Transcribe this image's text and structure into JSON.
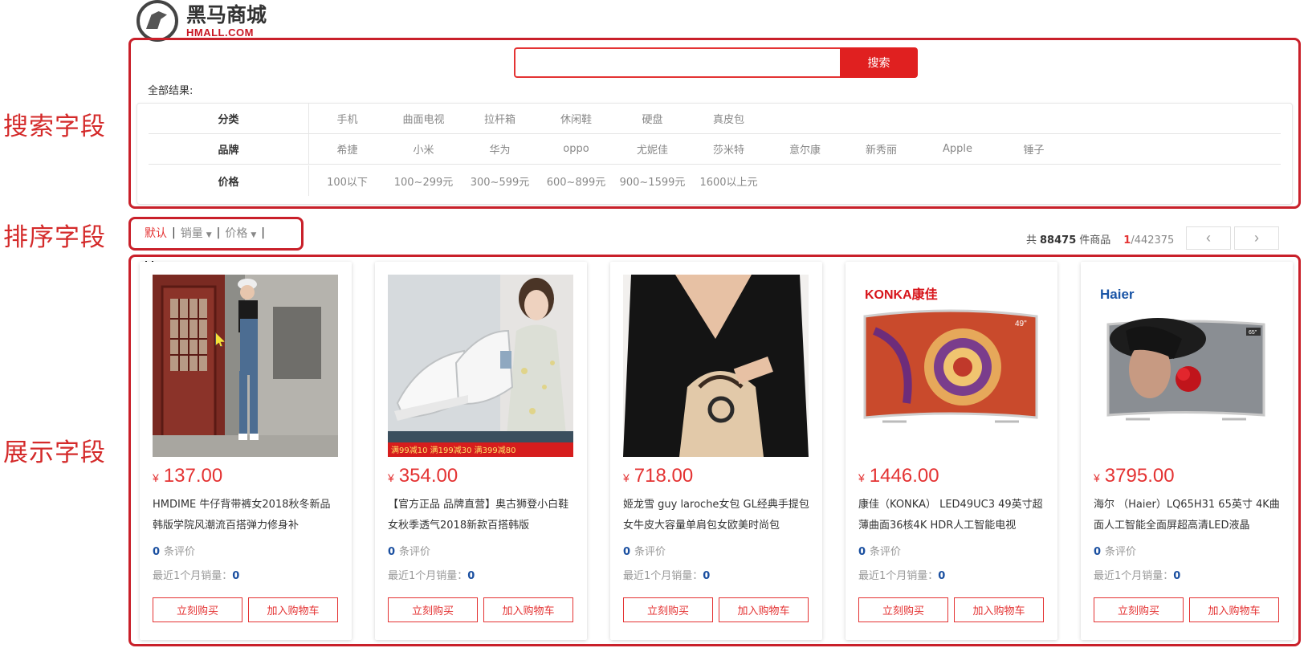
{
  "annotations": {
    "search": "搜索字段",
    "sort": "排序字段",
    "show": "展示字段"
  },
  "logo": {
    "name_cn": "黑马商城",
    "name_en": "HMALL.COM"
  },
  "search": {
    "value": "",
    "placeholder": "",
    "button_label": "搜索"
  },
  "all_results_label": "全部结果:",
  "filters": {
    "category": {
      "label": "分类",
      "values": [
        "手机",
        "曲面电视",
        "拉杆箱",
        "休闲鞋",
        "硬盘",
        "真皮包"
      ]
    },
    "brand": {
      "label": "品牌",
      "values": [
        "希捷",
        "小米",
        "华为",
        "oppo",
        "尤妮佳",
        "莎米特",
        "意尔康",
        "新秀丽",
        "Apple",
        "锤子"
      ]
    },
    "price": {
      "label": "价格",
      "values": [
        "100以下",
        "100~299元",
        "300~599元",
        "600~899元",
        "900~1599元",
        "1600以上元"
      ]
    }
  },
  "sort": {
    "default": "默认",
    "sales": "销量",
    "price": "价格",
    "separator": "|"
  },
  "pagination": {
    "prefix": "共",
    "total": "88475",
    "suffix": "件商品",
    "current": "1",
    "pages": "/442375",
    "prev_icon": "‹",
    "next_icon": "›"
  },
  "currency": "¥",
  "rating_suffix": "条评价",
  "sales_label": "最近1个月销量：",
  "buy_label": "立刻购买",
  "cart_label": "加入购物车",
  "products": [
    {
      "price": "137.00",
      "title": "HMDIME 牛仔背带裤女2018秋冬新品 韩版学院风潮流百搭弹力修身补",
      "ratings": "0",
      "sales": "0"
    },
    {
      "price": "354.00",
      "title": "【官方正品 品牌直营】奥古狮登小白鞋女秋季透气2018新款百搭韩版",
      "ratings": "0",
      "sales": "0",
      "banner": "满99减10 满199减30 满399减80"
    },
    {
      "price": "718.00",
      "title": "姬龙雪 guy laroche女包 GL经典手提包女牛皮大容量单肩包女欧美时尚包",
      "ratings": "0",
      "sales": "0"
    },
    {
      "price": "1446.00",
      "title": "康佳（KONKA） LED49UC3 49英寸超薄曲面36核4K HDR人工智能电视",
      "ratings": "0",
      "sales": "0",
      "brand_logo": "KONKA康佳"
    },
    {
      "price": "3795.00",
      "title": "海尔 （Haier）LQ65H31 65英寸 4K曲面人工智能全面屏超高清LED液晶",
      "ratings": "0",
      "sales": "0",
      "brand_logo": "Haier"
    }
  ]
}
